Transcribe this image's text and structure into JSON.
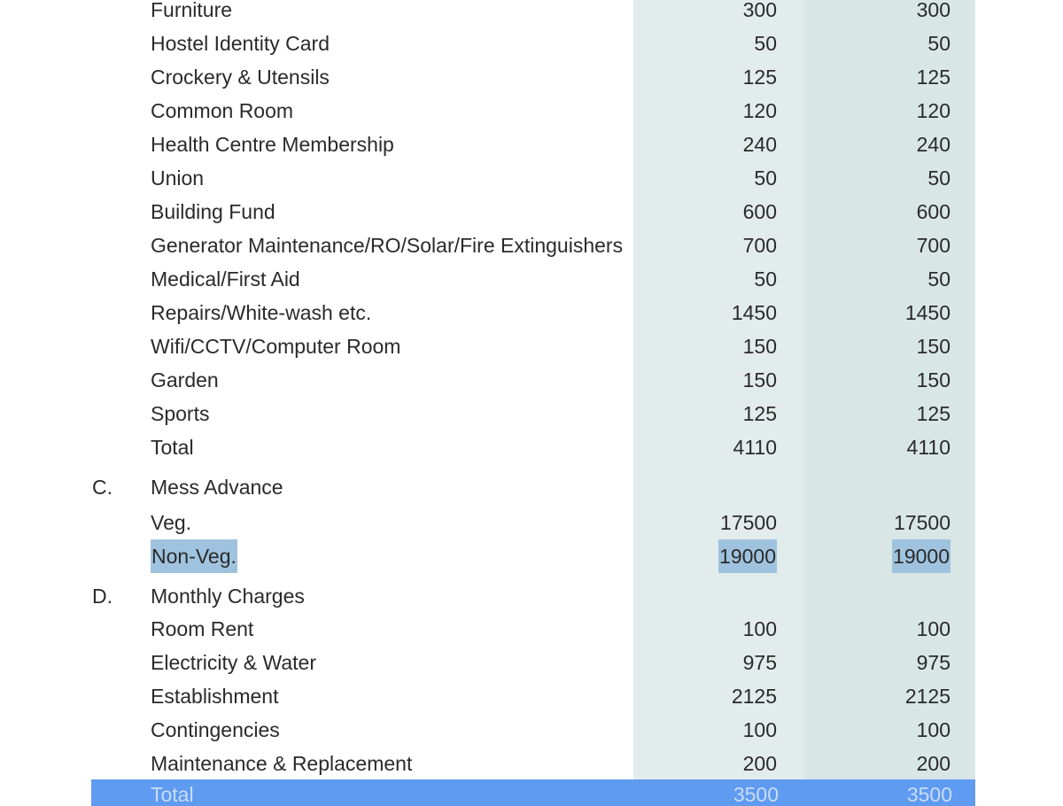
{
  "rows": [
    {
      "label": "Furniture",
      "v1": "300",
      "v2": "300"
    },
    {
      "label": "Hostel Identity Card",
      "v1": "50",
      "v2": "50"
    },
    {
      "label": "Crockery & Utensils",
      "v1": "125",
      "v2": "125"
    },
    {
      "label": "Common Room",
      "v1": "120",
      "v2": "120"
    },
    {
      "label": "Health Centre Membership",
      "v1": "240",
      "v2": "240"
    },
    {
      "label": "Union",
      "v1": "50",
      "v2": "50"
    },
    {
      "label": "Building Fund",
      "v1": "600",
      "v2": "600"
    },
    {
      "label": "Generator Maintenance/RO/Solar/Fire Extinguishers",
      "v1": "700",
      "v2": "700"
    },
    {
      "label": "Medical/First Aid",
      "v1": "50",
      "v2": "50"
    },
    {
      "label": "Repairs/White-wash etc.",
      "v1": "1450",
      "v2": "1450"
    },
    {
      "label": "Wifi/CCTV/Computer Room",
      "v1": "150",
      "v2": "150"
    },
    {
      "label": "Garden",
      "v1": "150",
      "v2": "150"
    },
    {
      "label": "Sports",
      "v1": "125",
      "v2": "125"
    },
    {
      "label": "Total",
      "v1": "4110",
      "v2": "4110"
    }
  ],
  "section_c": {
    "letter": "C.",
    "title": "Mess Advance",
    "rows": [
      {
        "label": "Veg.",
        "v1": "17500",
        "v2": "17500"
      },
      {
        "label": "Non-Veg.",
        "v1": "19000",
        "v2": "19000"
      }
    ]
  },
  "section_d": {
    "letter": "D.",
    "title": "Monthly Charges",
    "rows": [
      {
        "label": "Room Rent",
        "v1": "100",
        "v2": "100"
      },
      {
        "label": "Electricity & Water",
        "v1": "975",
        "v2": "975"
      },
      {
        "label": "Establishment",
        "v1": "2125",
        "v2": "2125"
      },
      {
        "label": "Contingencies",
        "v1": "100",
        "v2": "100"
      },
      {
        "label": "Maintenance & Replacement",
        "v1": "200",
        "v2": "200"
      }
    ],
    "total": {
      "label": "Total",
      "v1": "3500",
      "v2": "3500"
    }
  },
  "colors": {
    "selection": "#9fc3df",
    "selected_row_bar": "#5f9bf0",
    "col1_bg": "#e3ecec",
    "col2_bg": "#d9e6e6"
  }
}
